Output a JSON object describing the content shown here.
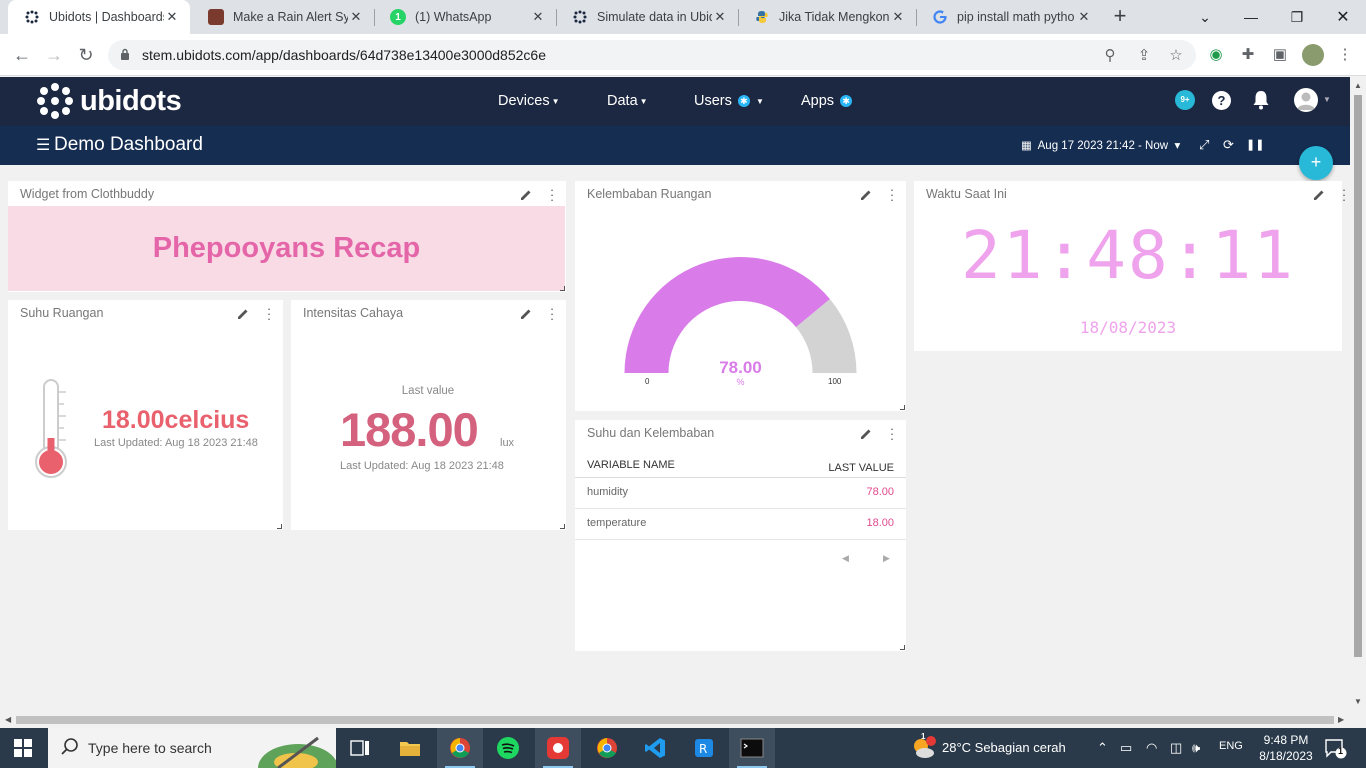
{
  "browser": {
    "tabs": [
      {
        "title": "Ubidots | Dashboards",
        "favicon": "ubidots-favicon",
        "active": true
      },
      {
        "title": "Make a Rain Alert Syst",
        "favicon": "project-favicon"
      },
      {
        "title": "(1) WhatsApp",
        "favicon": "whatsapp-favicon"
      },
      {
        "title": "Simulate data in Ubido",
        "favicon": "ubidots-favicon"
      },
      {
        "title": "Jika Tidak Mengkondi",
        "favicon": "python-favicon"
      },
      {
        "title": "pip install math pytho",
        "favicon": "google-favicon"
      }
    ],
    "url": "stem.ubidots.com/app/dashboards/64d738e13400e3000d852c6e"
  },
  "header": {
    "brand": "ubidots",
    "menu": {
      "devices": "Devices",
      "data": "Data",
      "users": "Users",
      "apps": "Apps"
    },
    "notification_badge": "9+",
    "help": "?"
  },
  "dashboard": {
    "title": "Demo Dashboard",
    "date_range": "Aug 17 2023 21:42 - Now"
  },
  "widgets": {
    "clothbuddy": {
      "title": "Widget from Clothbuddy",
      "text": "Phepooyans Recap"
    },
    "suhu": {
      "title": "Suhu Ruangan",
      "value": "18.00celcius",
      "updated": "Last Updated: Aug 18 2023 21:48"
    },
    "cahaya": {
      "title": "Intensitas Cahaya",
      "label": "Last value",
      "value": "188.00",
      "unit": "lux",
      "updated": "Last Updated: Aug 18 2023 21:48"
    },
    "kelembaban": {
      "title": "Kelembaban Ruangan",
      "value": "78.00",
      "unit": "%",
      "min": "0",
      "max": "100",
      "fraction": 0.78
    },
    "waktu": {
      "title": "Waktu Saat Ini",
      "time": "21:48:11",
      "date": "18/08/2023"
    },
    "table": {
      "title": "Suhu dan Kelembaban",
      "col_name": "VARIABLE NAME",
      "col_value": "LAST VALUE",
      "rows": [
        {
          "name": "humidity",
          "value": "78.00"
        },
        {
          "name": "temperature",
          "value": "18.00"
        }
      ]
    }
  },
  "taskbar": {
    "search_placeholder": "Type here to search",
    "weather": "28°C  Sebagian cerah",
    "weather_badge": "1",
    "language": "ENG",
    "time": "9:48 PM",
    "date": "8/18/2023",
    "notification_count": "1"
  },
  "colors": {
    "header_bg": "#1c2841",
    "dash_bar_bg": "#152d51",
    "accent": "#28b8d8",
    "gauge_fill": "#d97be8",
    "gauge_rest": "#d3d3d3",
    "clock_color": "#efa3ec"
  }
}
